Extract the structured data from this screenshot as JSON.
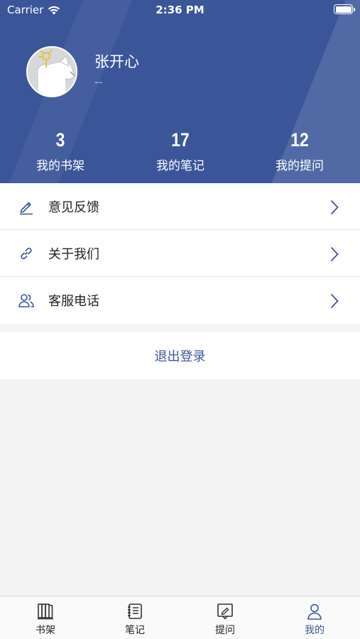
{
  "status_bar": {
    "carrier": "Carrier",
    "time": "2:36 PM"
  },
  "profile": {
    "name": "张开心",
    "subtitle": "--"
  },
  "stats": [
    {
      "value": "3",
      "label": "我的书架"
    },
    {
      "value": "17",
      "label": "我的笔记"
    },
    {
      "value": "12",
      "label": "我的提问"
    }
  ],
  "menu": [
    {
      "label": "意见反馈",
      "icon": "pencil-icon"
    },
    {
      "label": "关于我们",
      "icon": "link-icon"
    },
    {
      "label": "客服电话",
      "icon": "users-icon"
    }
  ],
  "logout_label": "退出登录",
  "tabs": [
    {
      "label": "书架",
      "icon": "bookshelf-icon",
      "active": false
    },
    {
      "label": "笔记",
      "icon": "notebook-icon",
      "active": false
    },
    {
      "label": "提问",
      "icon": "question-edit-icon",
      "active": false
    },
    {
      "label": "我的",
      "icon": "person-icon",
      "active": true
    }
  ],
  "colors": {
    "primary": "#3a5699",
    "background": "#f4f4f4"
  }
}
